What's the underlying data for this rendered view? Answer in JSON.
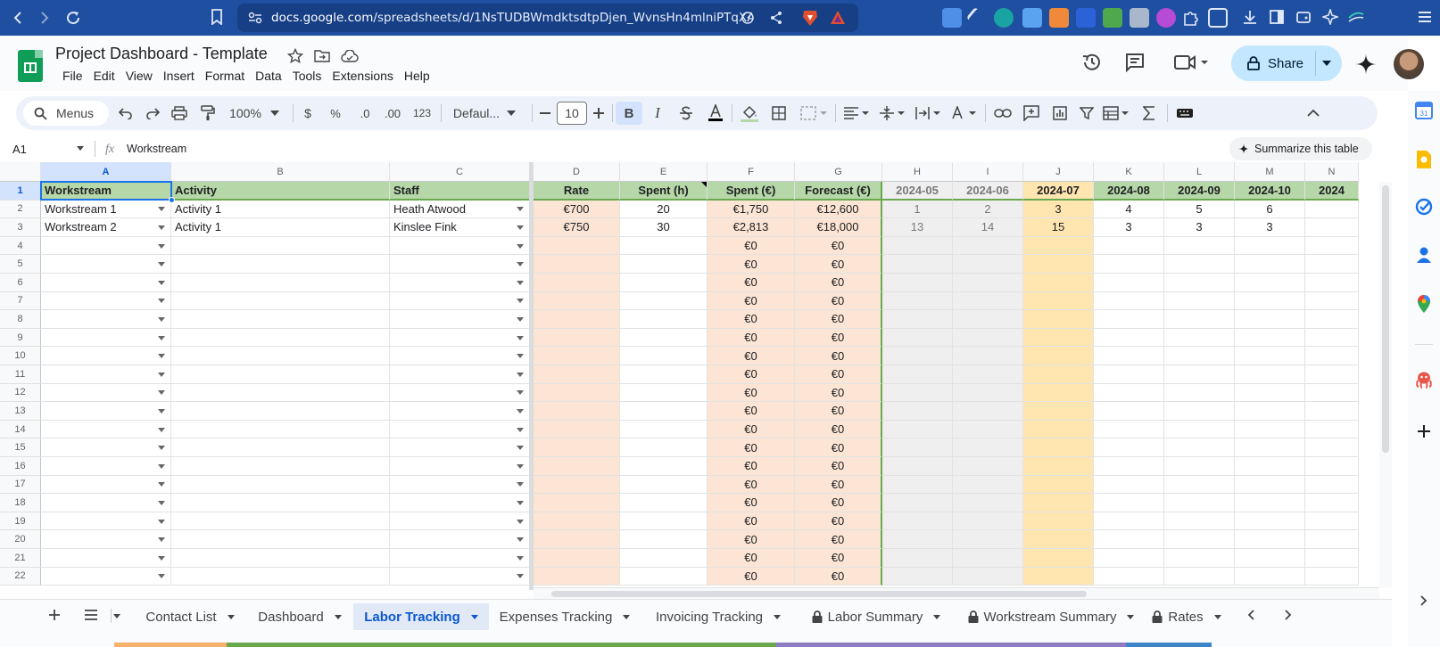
{
  "browser": {
    "url_host": "docs.google.com",
    "url_path": "/spreadsheets/d/1NsTUDBWmdktsdtpDjen_WvnsHn4mlniPTqXAfz..."
  },
  "header": {
    "title": "Project Dashboard - Template",
    "menus": [
      "File",
      "Edit",
      "View",
      "Insert",
      "Format",
      "Data",
      "Tools",
      "Extensions",
      "Help"
    ],
    "share_label": "Share"
  },
  "toolbar": {
    "search_label": "Menus",
    "zoom": "100%",
    "currency": "$",
    "percent": "%",
    "dec_minus": ".0",
    "dec_plus": ".00",
    "num_format": "123",
    "font": "Defaul...",
    "font_size": "10",
    "bold": "B",
    "italic": "I"
  },
  "formula_bar": {
    "cell_ref": "A1",
    "fx": "fx",
    "value": "Workstream",
    "summarize_label": "Summarize this table"
  },
  "grid": {
    "columns": [
      "A",
      "B",
      "C",
      "D",
      "E",
      "F",
      "G",
      "H",
      "I",
      "J",
      "K",
      "L",
      "M",
      "N"
    ],
    "header_row": [
      "Workstream",
      "Activity",
      "Staff",
      "Rate",
      "Spent (h)",
      "Spent (€)",
      "Forecast (€)",
      "2024-05",
      "2024-06",
      "2024-07",
      "2024-08",
      "2024-09",
      "2024-10",
      "2024"
    ],
    "rows": [
      [
        "Workstream 1",
        "Activity 1",
        "Heath Atwood",
        "€700",
        "20",
        "€1,750",
        "€12,600",
        "1",
        "2",
        "3",
        "4",
        "5",
        "6",
        ""
      ],
      [
        "Workstream 2",
        "Activity 1",
        "Kinslee Fink",
        "€750",
        "30",
        "€2,813",
        "€18,000",
        "13",
        "14",
        "15",
        "3",
        "3",
        "3",
        ""
      ]
    ],
    "empty_f": "€0",
    "empty_g": "€0",
    "row_numbers": [
      "1",
      "2",
      "3",
      "4",
      "5",
      "6",
      "7",
      "8",
      "9",
      "10",
      "11",
      "12",
      "13",
      "14",
      "15",
      "16",
      "17",
      "18",
      "19",
      "20",
      "21",
      "22"
    ],
    "colors": {
      "header_green": "#b6d7a8",
      "rate_peach": "#fce5d4",
      "past_grey": "#efefef",
      "current_yellow": "#ffe6b0"
    }
  },
  "sheet_tabs": [
    {
      "label": "Contact List",
      "locked": false,
      "active": false,
      "color": "#f6b26b"
    },
    {
      "label": "Dashboard",
      "locked": false,
      "active": false,
      "color": "#6aa84f"
    },
    {
      "label": "Labor Tracking",
      "locked": false,
      "active": true,
      "color": "#6aa84f"
    },
    {
      "label": "Expenses Tracking",
      "locked": false,
      "active": false,
      "color": "#6aa84f"
    },
    {
      "label": "Invoicing Tracking",
      "locked": false,
      "active": false,
      "color": "#6aa84f"
    },
    {
      "label": "Labor Summary",
      "locked": true,
      "active": false,
      "color": "#8e7cc3"
    },
    {
      "label": "Workstream Summary",
      "locked": true,
      "active": false,
      "color": "#8e7cc3"
    },
    {
      "label": "Rates",
      "locked": true,
      "active": false,
      "color": "#3d85c6"
    }
  ]
}
